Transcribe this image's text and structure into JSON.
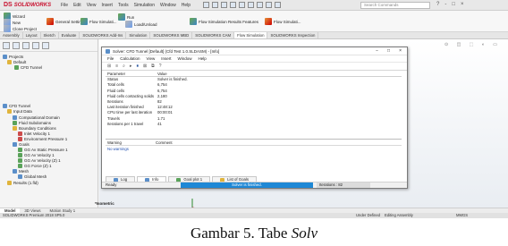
{
  "app": {
    "brand_mark": "DS",
    "brand": "SOLIDWORKS",
    "menu": [
      "File",
      "Edit",
      "View",
      "Insert",
      "Tools",
      "Simulation",
      "Window",
      "Help"
    ],
    "search_placeholder": "Search Commands",
    "help_icons": [
      "?",
      "-",
      "□",
      "×"
    ]
  },
  "ribbon": {
    "buttons": [
      "Wizard",
      "New",
      "Clone Project",
      "General Settings",
      "Flow Simulati...",
      "Run",
      "Load/Unload",
      "Flow Simulation Results Features",
      "Flow Simulati..."
    ]
  },
  "command_tabs": [
    "Assembly",
    "Layout",
    "Sketch",
    "Evaluate",
    "SOLIDWORKS Add-Ins",
    "Simulation",
    "SOLIDWORKS MBD",
    "SOLIDWORKS CAM",
    "Flow Simulation",
    "SOLIDWORKS Inspection"
  ],
  "tree": {
    "items": [
      {
        "label": "Projects"
      },
      {
        "label": "Default"
      },
      {
        "label": "CFD Tunnel"
      },
      {
        "label": "CFD Tunnel"
      },
      {
        "label": "Input Data"
      },
      {
        "label": "Computational Domain"
      },
      {
        "label": "Fluid Subdomains"
      },
      {
        "label": "Boundary Conditions"
      },
      {
        "label": "Inlet Velocity 1"
      },
      {
        "label": "Environment Pressure 1"
      },
      {
        "label": "Goals"
      },
      {
        "label": "GG Av Static Pressure 1"
      },
      {
        "label": "GG Av Velocity 1"
      },
      {
        "label": "GG Av Velocity (Z) 1"
      },
      {
        "label": "GG Force (Z) 1"
      },
      {
        "label": "Mesh"
      },
      {
        "label": "Global Mesh"
      },
      {
        "label": "Results (1.fld)"
      }
    ]
  },
  "graphics": {
    "view_label": "*Isometric",
    "view_icons": "⊙ ◫ ⬚ ◐ ▭"
  },
  "solver": {
    "title": "Solver: CFD Tunnel [Default] (Cfd Test 1.0.SLDASM) - [Info]",
    "window_controls": [
      "−",
      "□",
      "×"
    ],
    "menu": [
      "File",
      "Calculation",
      "View",
      "Insert",
      "Window",
      "Help"
    ],
    "toolbar_icons": [
      "⊞",
      "≡",
      "⌕",
      "▸",
      "⏸",
      "⊠",
      "⧉",
      "?"
    ],
    "info_header": {
      "parameter": "Parameter",
      "value": "Value"
    },
    "info_rows": [
      {
        "k": "Status",
        "v": "Solver is finished."
      },
      {
        "k": "Total cells",
        "v": "6,754"
      },
      {
        "k": "Fluid cells",
        "v": "6,754"
      },
      {
        "k": "Fluid cells contacting solids",
        "v": "2,180"
      },
      {
        "k": "Iterations",
        "v": "82"
      },
      {
        "k": "Last iteration finished",
        "v": "12:48:12"
      },
      {
        "k": "CPU time per last iteration",
        "v": "00:00:01"
      },
      {
        "k": "Travels",
        "v": "1.71"
      },
      {
        "k": "Iterations per 1 travel",
        "v": "41"
      }
    ],
    "warn_header": {
      "warning": "Warning",
      "comment": "Comment"
    },
    "warn_rows": [
      "No warnings"
    ],
    "tabs": [
      "Log",
      "Info",
      "Goal plot 1",
      "List of Goals"
    ],
    "status_ready": "Ready",
    "progress_label": "Solver is finished.",
    "progress_value": 1.0,
    "iterations_label": "Iterations : 82"
  },
  "model_tabs": [
    "Model",
    "3D Views",
    "Motion Study 1"
  ],
  "statusbar": {
    "left": "SOLIDWORKS Premium 2018 SP5.0",
    "r1": "Under Defined",
    "r2": "Editing Assembly",
    "r3": "MMGS"
  },
  "caption": {
    "label": "Gambar 5.",
    "prefix": "Tabe",
    "italic": "Solv"
  }
}
